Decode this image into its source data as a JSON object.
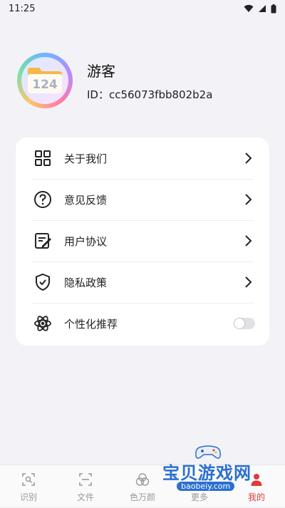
{
  "status_bar": {
    "time": "11:25"
  },
  "profile": {
    "nickname": "游客",
    "user_id": "ID：cc56073fbb802b2a",
    "avatar_text": "124"
  },
  "menu": {
    "items": [
      {
        "label": "关于我们",
        "icon": "grid-icon"
      },
      {
        "label": "意见反馈",
        "icon": "question-icon"
      },
      {
        "label": "用户协议",
        "icon": "document-edit-icon"
      },
      {
        "label": "隐私政策",
        "icon": "shield-check-icon"
      },
      {
        "label": "个性化推荐",
        "icon": "atom-icon",
        "toggle": false
      }
    ]
  },
  "tabbar": {
    "tabs": [
      {
        "label": "识别",
        "icon": "scan-icon"
      },
      {
        "label": "文件",
        "icon": "file-frame-icon"
      },
      {
        "label": "色万颜",
        "icon": "color-circles-icon"
      },
      {
        "label": "更多",
        "icon": "more-icon"
      },
      {
        "label": "我的",
        "icon": "user-icon"
      }
    ],
    "active_index": 4
  },
  "watermark": {
    "text": "宝贝游戏网",
    "url": "baobeiy.com"
  },
  "colors": {
    "active": "#e03a3a",
    "inactive": "#9a9a9a",
    "background": "#f2f2f7"
  }
}
